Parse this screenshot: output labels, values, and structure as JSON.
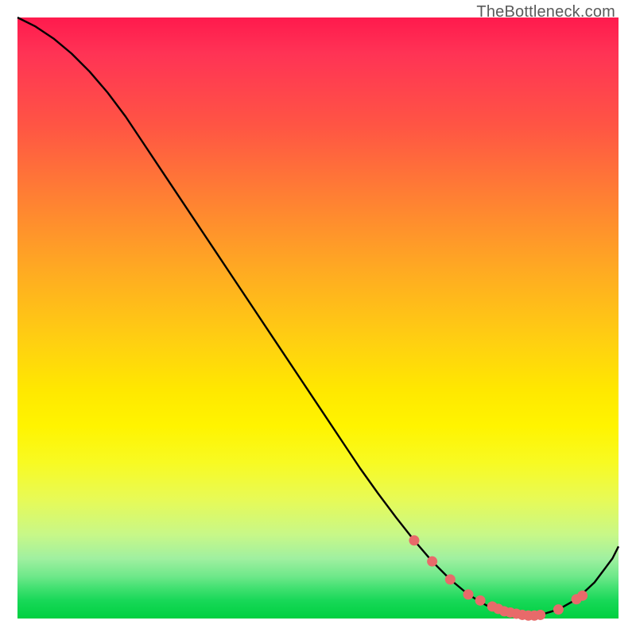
{
  "attribution": "TheBottleneck.com",
  "colors": {
    "gradient_top": "#ff1a4d",
    "gradient_mid": "#fff400",
    "gradient_bottom": "#00d040",
    "line": "#000000",
    "marker": "#e86a6a"
  },
  "chart_data": {
    "type": "line",
    "title": "",
    "xlabel": "",
    "ylabel": "",
    "xlim": [
      0,
      100
    ],
    "ylim": [
      0,
      100
    ],
    "x": [
      0,
      3,
      6,
      9,
      12,
      15,
      18,
      21,
      24,
      27,
      30,
      33,
      36,
      39,
      42,
      45,
      48,
      51,
      54,
      57,
      60,
      63,
      66,
      69,
      72,
      75,
      78,
      81,
      84,
      87,
      90,
      93,
      96,
      99,
      100
    ],
    "values": [
      100,
      98.5,
      96.5,
      94.0,
      91.0,
      87.5,
      83.5,
      79.0,
      74.5,
      70.0,
      65.5,
      61.0,
      56.5,
      52.0,
      47.5,
      43.0,
      38.5,
      34.0,
      29.5,
      25.0,
      20.8,
      16.8,
      13.0,
      9.5,
      6.5,
      4.0,
      2.2,
      1.0,
      0.5,
      0.6,
      1.5,
      3.2,
      6.0,
      10.0,
      12.0
    ],
    "markers": {
      "x": [
        66,
        69,
        72,
        75,
        77,
        79,
        80,
        81,
        82,
        83,
        84,
        85,
        86,
        87,
        90,
        93,
        94
      ],
      "y": [
        13.0,
        9.5,
        6.5,
        4.0,
        3.0,
        2.0,
        1.6,
        1.2,
        1.0,
        0.8,
        0.6,
        0.5,
        0.5,
        0.6,
        1.5,
        3.2,
        3.8
      ]
    }
  }
}
